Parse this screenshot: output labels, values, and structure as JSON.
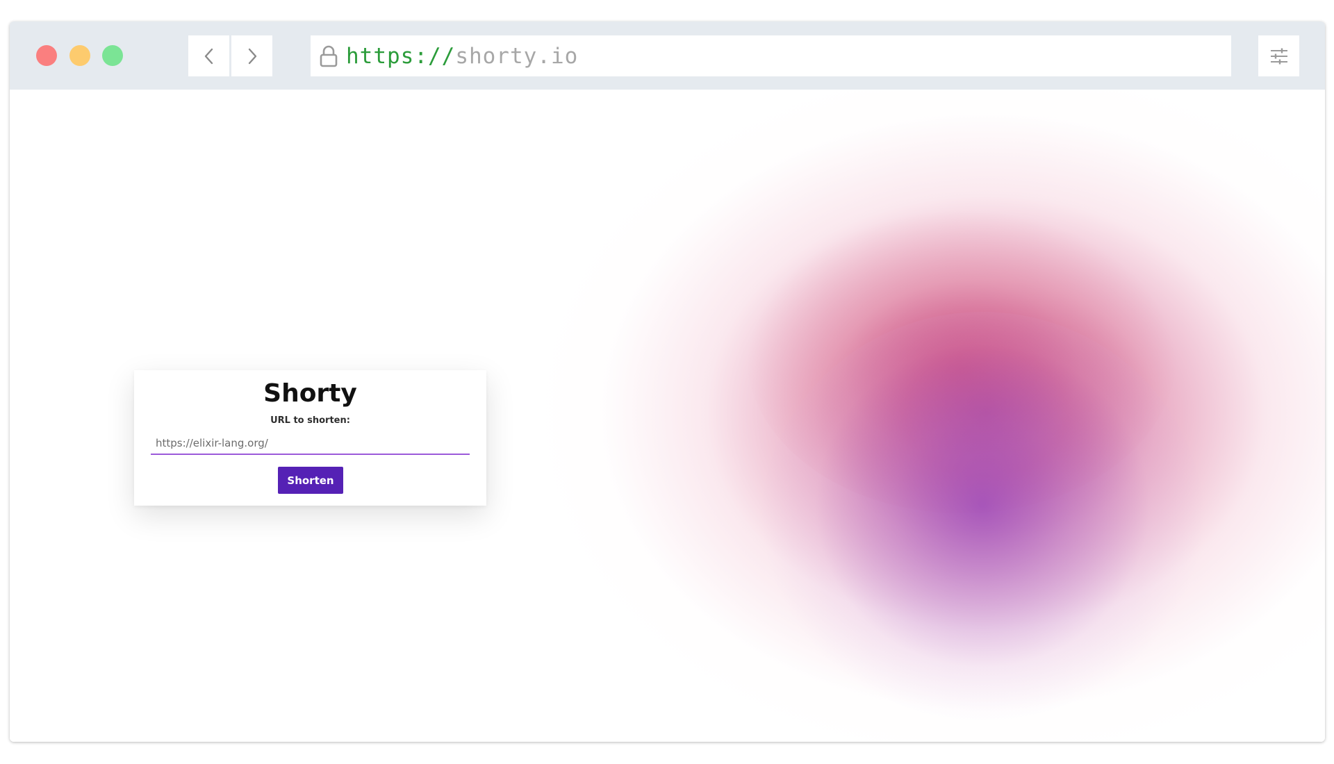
{
  "browser": {
    "window_controls": {
      "close_color": "#fa7f7f",
      "minimize_color": "#fdcb6e",
      "maximize_color": "#7be495"
    },
    "nav": {
      "back_icon": "chevron-left-icon",
      "forward_icon": "chevron-right-icon"
    },
    "address": {
      "lock_icon": "lock-icon",
      "scheme": "https://",
      "host": "shorty.io"
    },
    "settings_icon": "sliders-icon"
  },
  "app": {
    "title": "Shorty",
    "field_label": "URL to shorten:",
    "input_placeholder": "https://elixir-lang.org/",
    "input_value": "",
    "submit_label": "Shorten",
    "accent_color": "#5521b5"
  }
}
